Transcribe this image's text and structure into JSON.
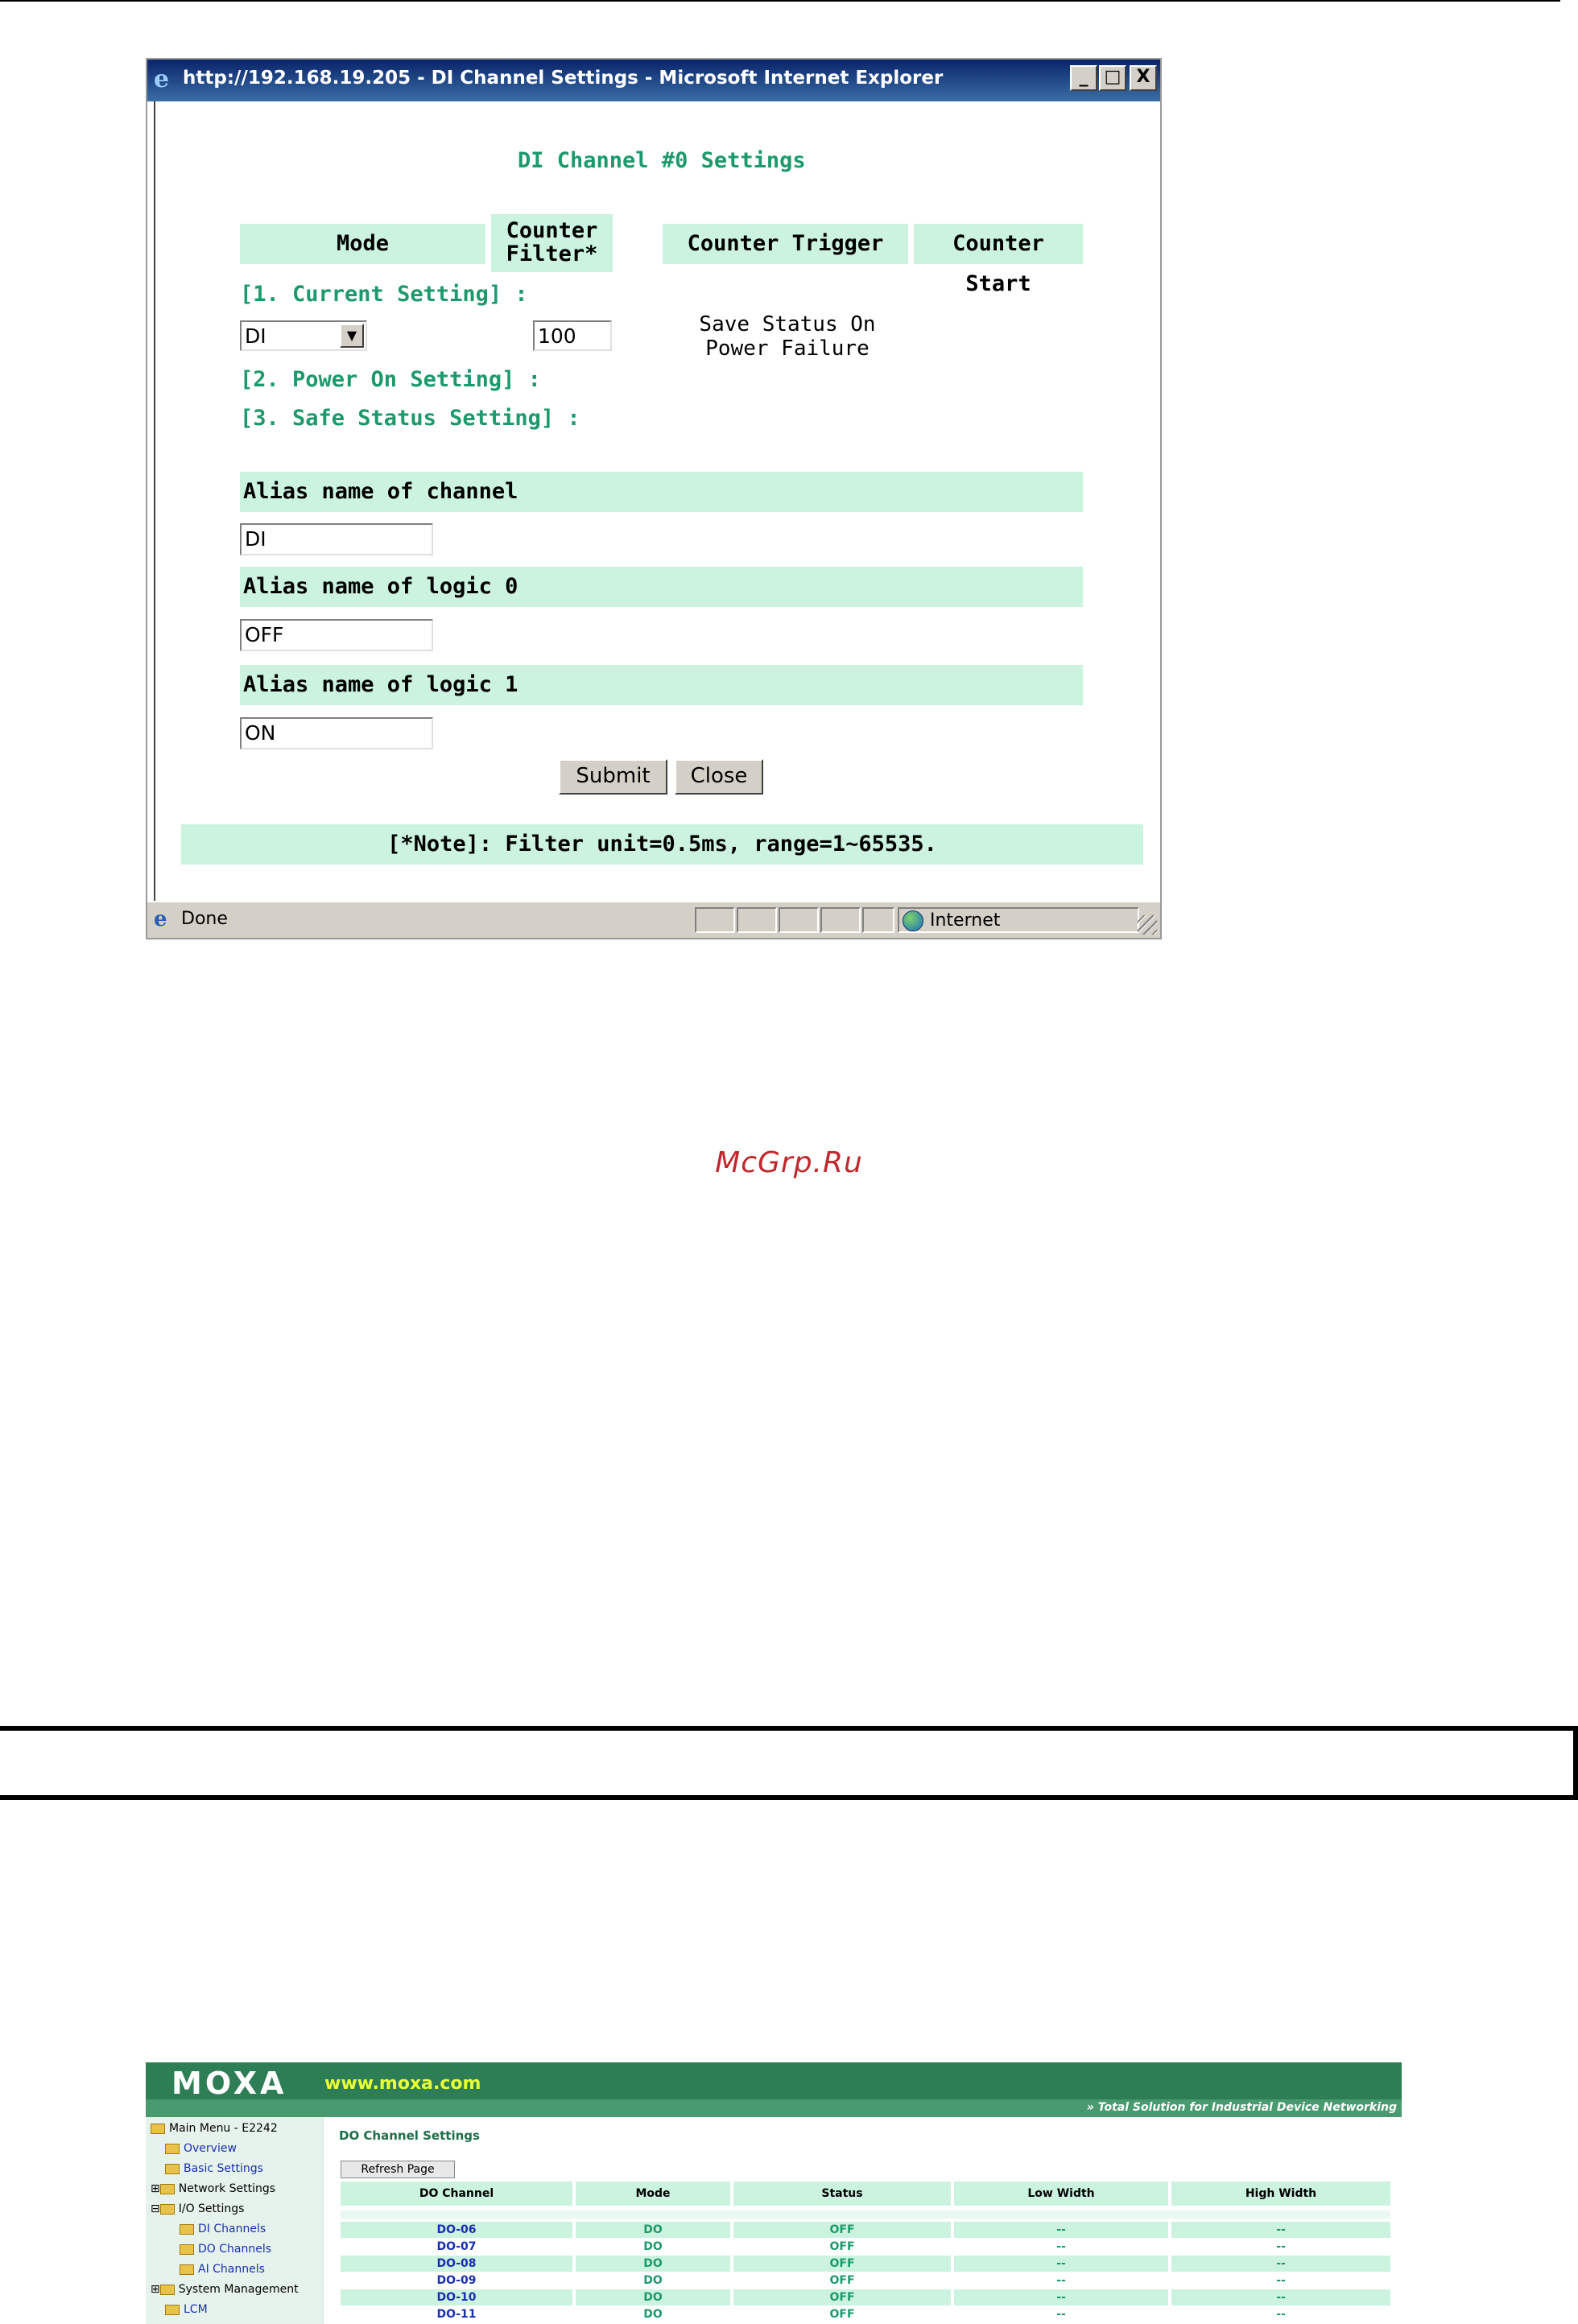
{
  "window": {
    "title": "http://192.168.19.205 - DI Channel Settings - Microsoft Internet Explorer",
    "minimize": "_",
    "maximize": "□",
    "close": "X",
    "status_left": "Done",
    "status_zone": "Internet"
  },
  "form": {
    "heading": "DI Channel #0 Settings",
    "headers": {
      "mode": "Mode",
      "counter_filter_1": "Counter",
      "counter_filter_2": "Filter*",
      "counter_trigger": "Counter Trigger",
      "counter_start": "Counter Start"
    },
    "current_setting": "[1. Current Setting] :",
    "mode_value": "DI",
    "filter_value": "100",
    "save_status_1": "Save Status On",
    "save_status_2": "Power Failure",
    "power_on_setting": "[2. Power On Setting] :",
    "safe_status_setting": "[3. Safe Status Setting] :",
    "alias_channel_label": "Alias name of  channel",
    "alias_channel_value": "DI",
    "alias_logic0_label": "Alias name of logic 0",
    "alias_logic0_value": "OFF",
    "alias_logic1_label": "Alias name of logic 1",
    "alias_logic1_value": "ON",
    "submit": "Submit",
    "close": "Close",
    "note": "[*Note]: Filter unit=0.5ms, range=1~65535."
  },
  "watermark": "McGrp.Ru",
  "moxa": {
    "logo": "MOXA",
    "www": "www.moxa.com",
    "tagline": "Total Solution for Industrial Device Networking",
    "tree": [
      "Main Menu - E2242",
      "Overview",
      "Basic Settings",
      "Network Settings",
      "I/O Settings",
      "DI Channels",
      "DO Channels",
      "AI Channels",
      "System Management",
      "LCM"
    ],
    "page_title": "DO Channel Settings",
    "refresh": "Refresh Page",
    "columns": [
      "DO Channel",
      "Mode",
      "Status",
      "Low Width",
      "High Width"
    ],
    "rows": [
      [
        "DO-06",
        "DO",
        "OFF",
        "--",
        "--"
      ],
      [
        "DO-07",
        "DO",
        "OFF",
        "--",
        "--"
      ],
      [
        "DO-08",
        "DO",
        "OFF",
        "--",
        "--"
      ],
      [
        "DO-09",
        "DO",
        "OFF",
        "--",
        "--"
      ],
      [
        "DO-10",
        "DO",
        "OFF",
        "--",
        "--"
      ],
      [
        "DO-11",
        "DO",
        "OFF",
        "--",
        "--"
      ]
    ],
    "colors": {
      "header_green": "#2d7d55",
      "channel_blue": "#1a2fb0",
      "value_green": "#1d9a6c"
    }
  }
}
